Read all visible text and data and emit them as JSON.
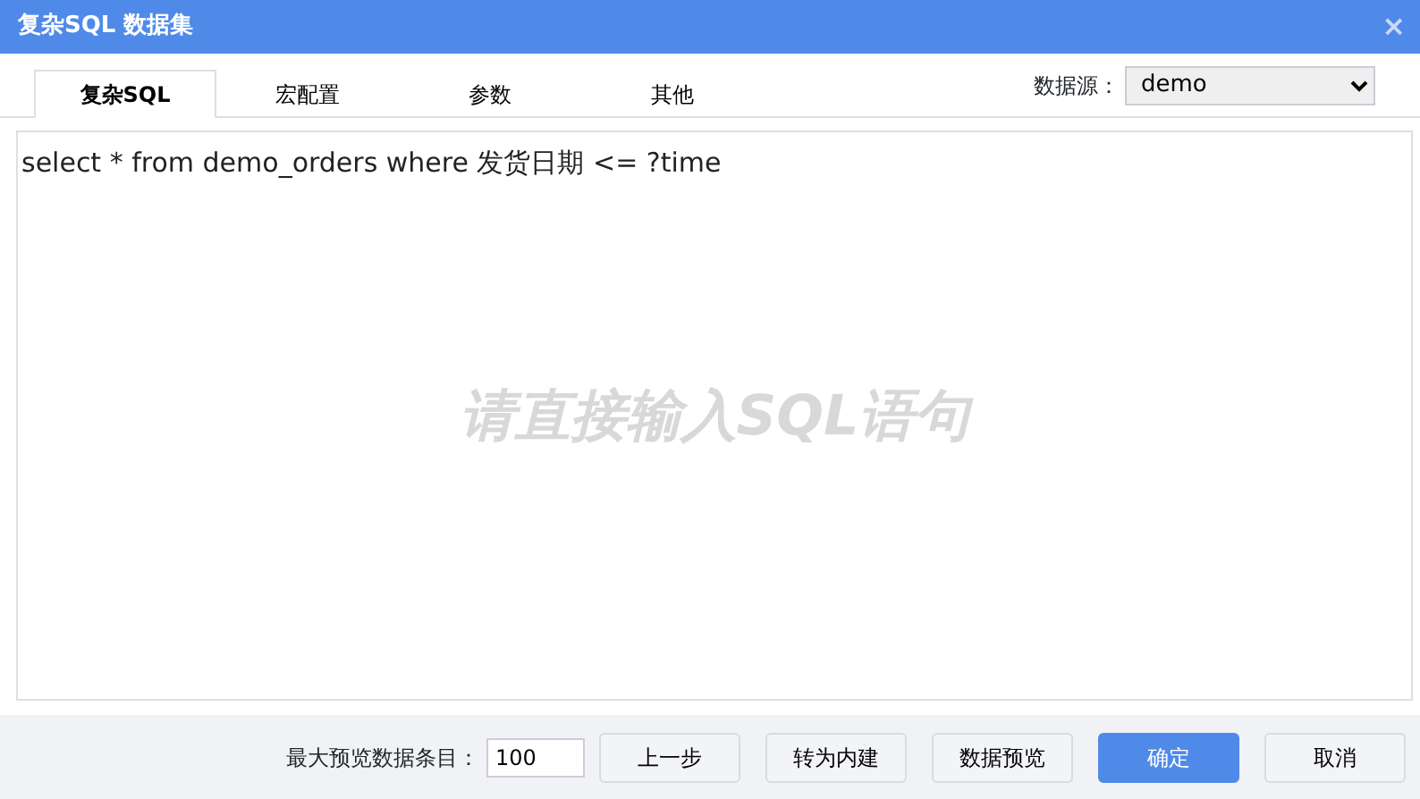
{
  "window": {
    "title": "复杂SQL 数据集",
    "close": "×"
  },
  "tabs": [
    {
      "label": "复杂SQL",
      "selected": true
    },
    {
      "label": "宏配置",
      "selected": false
    },
    {
      "label": "参数",
      "selected": false
    },
    {
      "label": "其他",
      "selected": false
    }
  ],
  "datasource": {
    "label": "数据源：",
    "value": "demo"
  },
  "editor": {
    "value": "select * from demo_orders where 发货日期 <= ?time",
    "placeholder": "请直接输入SQL语句"
  },
  "footer": {
    "max_rows_label": "最大预览数据条目：",
    "max_rows_value": "100",
    "buttons": [
      {
        "label": "上一步",
        "kind": "default"
      },
      {
        "label": "转为内建",
        "kind": "default"
      },
      {
        "label": "数据预览",
        "kind": "default"
      },
      {
        "label": "确定",
        "kind": "primary"
      },
      {
        "label": "取消",
        "kind": "default"
      }
    ]
  }
}
